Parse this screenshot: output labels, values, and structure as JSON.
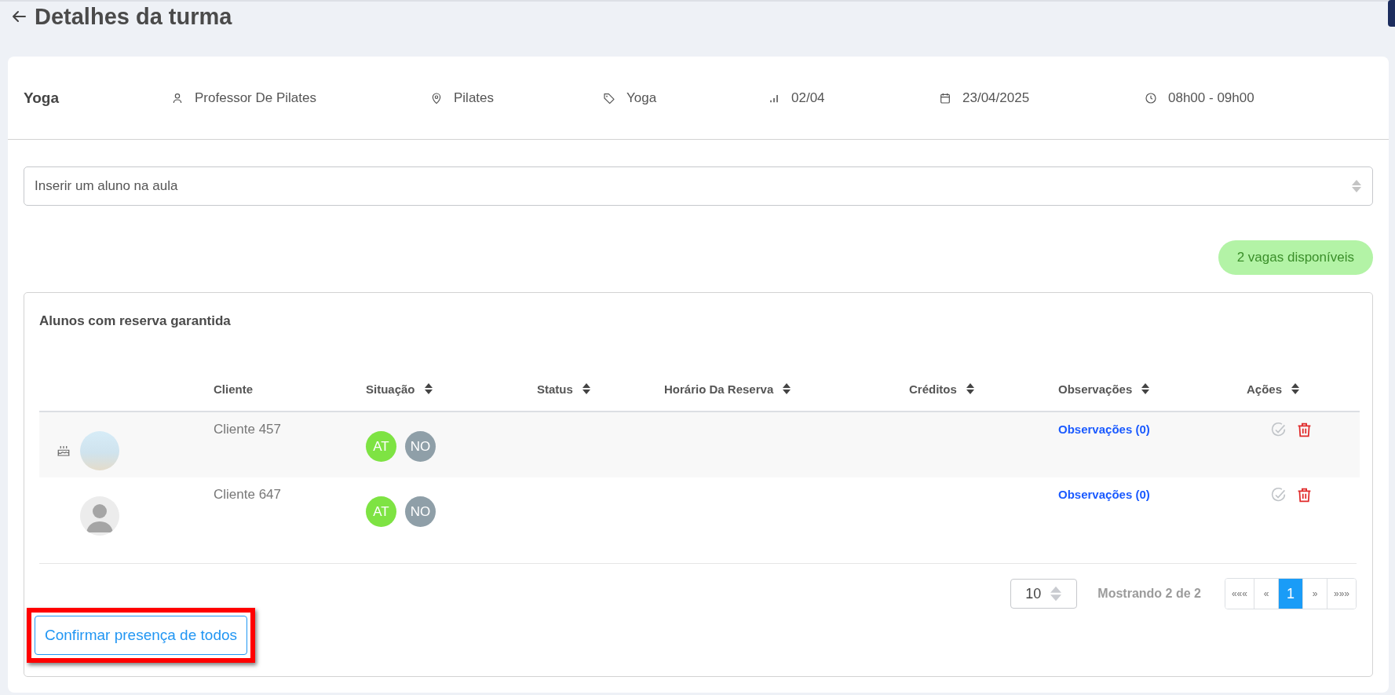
{
  "page": {
    "title": "Detalhes da turma"
  },
  "class_info": {
    "name": "Yoga",
    "items": [
      {
        "kind": "teacher",
        "text": "Professor De Pilates"
      },
      {
        "kind": "location",
        "text": "Pilates"
      },
      {
        "kind": "category",
        "text": "Yoga"
      },
      {
        "kind": "occupancy",
        "text": "02/04"
      },
      {
        "kind": "date",
        "text": "23/04/2025"
      },
      {
        "kind": "time",
        "text": "08h00 - 09h00"
      }
    ]
  },
  "student_select": {
    "placeholder": "Inserir um aluno na aula"
  },
  "availability_badge": "2 vagas disponíveis",
  "table": {
    "title": "Alunos com reserva garantida",
    "columns": [
      {
        "label": "Cliente",
        "sortable": false
      },
      {
        "label": "Situação",
        "sortable": true
      },
      {
        "label": "Status",
        "sortable": true
      },
      {
        "label": "Horário Da Reserva",
        "sortable": true
      },
      {
        "label": "Créditos",
        "sortable": true
      },
      {
        "label": "Observações",
        "sortable": true
      },
      {
        "label": "Ações",
        "sortable": true
      }
    ],
    "rows": [
      {
        "birthday": true,
        "kind": "photo",
        "client": "Cliente 457",
        "badges": [
          {
            "text": "AT",
            "color": "#7ee343"
          },
          {
            "text": "NO",
            "color": "#8f9fa8"
          }
        ],
        "notes_link": "Observações (0)"
      },
      {
        "birthday": false,
        "kind": "silhouette",
        "client": "Cliente 647",
        "badges": [
          {
            "text": "AT",
            "color": "#7ee343"
          },
          {
            "text": "NO",
            "color": "#8f9fa8"
          }
        ],
        "notes_link": "Observações (0)"
      }
    ],
    "page_size": "10",
    "summary": "Mostrando 2 de 2",
    "pagination": [
      {
        "label": "«««",
        "selected": false
      },
      {
        "label": "«",
        "selected": false
      },
      {
        "label": "1",
        "selected": true
      },
      {
        "label": "»",
        "selected": false
      },
      {
        "label": "»»»",
        "selected": false
      }
    ]
  },
  "confirm_button": {
    "label": "Confirmar presença de todos",
    "highlighted": true
  }
}
